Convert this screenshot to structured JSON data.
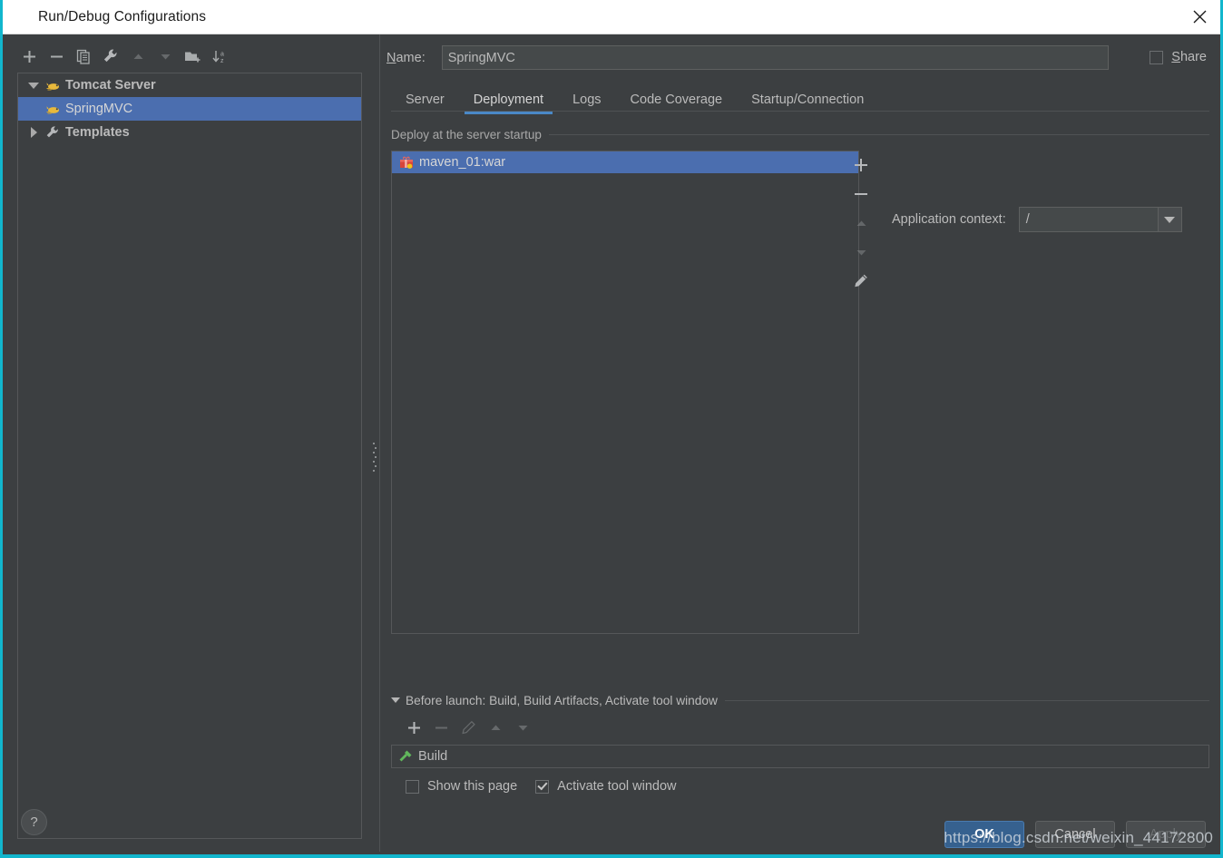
{
  "window": {
    "title": "Run/Debug Configurations",
    "app_icon": "intellij-idea-icon",
    "close_icon": "close-icon",
    "accent_blue": "#4b6eaf",
    "border_color": "#12b6cd"
  },
  "left_toolbar": [
    {
      "name": "add-configuration-button",
      "icon": "plus-icon",
      "enabled": true
    },
    {
      "name": "remove-configuration-button",
      "icon": "minus-icon",
      "enabled": true
    },
    {
      "name": "copy-configuration-button",
      "icon": "copy-icon",
      "enabled": true
    },
    {
      "name": "edit-templates-button",
      "icon": "wrench-icon",
      "enabled": true
    },
    {
      "name": "move-up-button",
      "icon": "arrow-up-icon",
      "enabled": false
    },
    {
      "name": "move-down-button",
      "icon": "arrow-down-icon",
      "enabled": false
    },
    {
      "name": "create-folder-button",
      "icon": "folder-add-icon",
      "enabled": true
    },
    {
      "name": "sort-configurations-button",
      "icon": "sort-az-icon",
      "enabled": true
    }
  ],
  "tree": [
    {
      "label": "Tomcat Server",
      "icon": "tomcat-icon",
      "expander": "down",
      "selected": false,
      "indent": 0,
      "bold": true
    },
    {
      "label": "SpringMVC",
      "icon": "tomcat-icon",
      "expander": "none",
      "selected": true,
      "indent": 1,
      "bold": false
    },
    {
      "label": "Templates",
      "icon": "wrench-icon",
      "expander": "right",
      "selected": false,
      "indent": 0,
      "bold": true
    }
  ],
  "name_field": {
    "label": "Name:",
    "mnemonic": "N",
    "value": "SpringMVC",
    "placeholder": ""
  },
  "share": {
    "label": "Share",
    "mnemonic": "S",
    "checked": false
  },
  "tabs": [
    {
      "label": "Server",
      "active": false
    },
    {
      "label": "Deployment",
      "active": true
    },
    {
      "label": "Logs",
      "active": false
    },
    {
      "label": "Code Coverage",
      "active": false
    },
    {
      "label": "Startup/Connection",
      "active": false
    }
  ],
  "deploy_group": {
    "title": "Deploy at the server startup",
    "items": [
      {
        "label": "maven_01:war",
        "icon": "artifact-icon",
        "selected": true
      }
    ],
    "side_toolbar": [
      {
        "name": "add-artifact-button",
        "icon": "plus-icon",
        "enabled": true
      },
      {
        "name": "remove-artifact-button",
        "icon": "minus-icon",
        "enabled": true
      },
      {
        "name": "move-artifact-up-button",
        "icon": "arrow-up-icon",
        "enabled": false
      },
      {
        "name": "move-artifact-down-button",
        "icon": "arrow-down-icon",
        "enabled": false
      },
      {
        "name": "edit-artifact-button",
        "icon": "pencil-icon",
        "enabled": true
      }
    ]
  },
  "application_context": {
    "label": "Application context:",
    "value": "/",
    "options": [
      "/"
    ]
  },
  "before_launch": {
    "title": "Before launch: Build, Build Artifacts, Activate tool window",
    "mnemonic": "B",
    "toolbar": [
      {
        "name": "add-task-button",
        "icon": "plus-icon",
        "enabled": true
      },
      {
        "name": "remove-task-button",
        "icon": "minus-icon",
        "enabled": false
      },
      {
        "name": "edit-task-button",
        "icon": "pencil-icon",
        "enabled": false
      },
      {
        "name": "move-task-up-button",
        "icon": "arrow-up-icon",
        "enabled": false
      },
      {
        "name": "move-task-down-button",
        "icon": "arrow-down-icon",
        "enabled": false
      }
    ],
    "tasks": [
      {
        "label": "Build",
        "icon": "build-hammer-icon"
      }
    ],
    "show_this_page": {
      "label": "Show this page",
      "checked": false
    },
    "activate_tool_window": {
      "label": "Activate tool window",
      "checked": true
    }
  },
  "footer": {
    "help_label": "?",
    "ok_label": "OK",
    "cancel_label": "Cancel",
    "apply_label": "Apply",
    "apply_enabled": false
  },
  "watermark": "https://blog.csdn.net/weixin_44172800"
}
